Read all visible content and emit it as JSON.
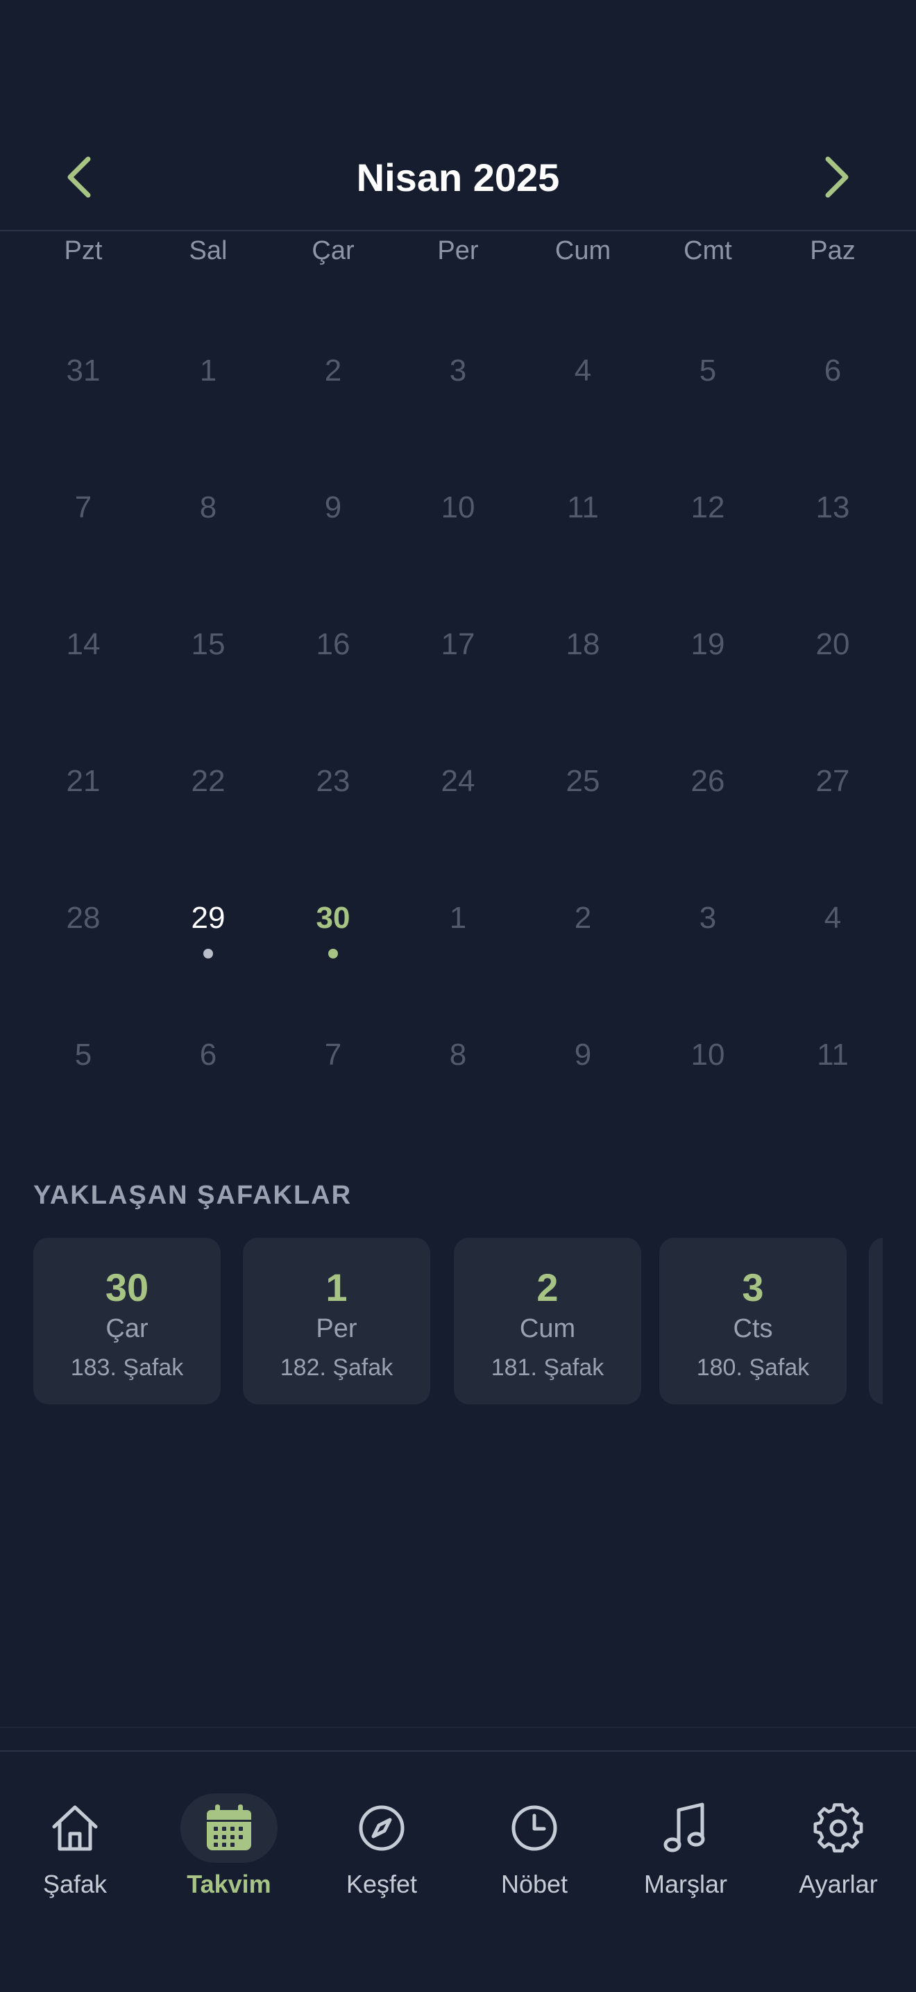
{
  "header": {
    "month_title": "Nisan 2025"
  },
  "weekdays": [
    "Pzt",
    "Sal",
    "Çar",
    "Per",
    "Cum",
    "Cmt",
    "Paz"
  ],
  "days": [
    {
      "label": "31"
    },
    {
      "label": "1"
    },
    {
      "label": "2"
    },
    {
      "label": "3"
    },
    {
      "label": "4"
    },
    {
      "label": "5"
    },
    {
      "label": "6"
    },
    {
      "label": "7"
    },
    {
      "label": "8"
    },
    {
      "label": "9"
    },
    {
      "label": "10"
    },
    {
      "label": "11"
    },
    {
      "label": "12"
    },
    {
      "label": "13"
    },
    {
      "label": "14"
    },
    {
      "label": "15"
    },
    {
      "label": "16"
    },
    {
      "label": "17"
    },
    {
      "label": "18"
    },
    {
      "label": "19"
    },
    {
      "label": "20"
    },
    {
      "label": "21"
    },
    {
      "label": "22"
    },
    {
      "label": "23"
    },
    {
      "label": "24"
    },
    {
      "label": "25"
    },
    {
      "label": "26"
    },
    {
      "label": "27"
    },
    {
      "label": "28"
    },
    {
      "label": "29",
      "state": "today",
      "dot": "#b9bec8"
    },
    {
      "label": "30",
      "state": "selected",
      "dot": "#a7c485"
    },
    {
      "label": "1"
    },
    {
      "label": "2"
    },
    {
      "label": "3"
    },
    {
      "label": "4"
    },
    {
      "label": "5"
    },
    {
      "label": "6"
    },
    {
      "label": "7"
    },
    {
      "label": "8"
    },
    {
      "label": "9"
    },
    {
      "label": "10"
    },
    {
      "label": "11"
    }
  ],
  "upcoming": {
    "title": "YAKLAŞAN ŞAFAKLAR",
    "cards": [
      {
        "day": "30",
        "weekday": "Çar",
        "safak": "183. Şafak"
      },
      {
        "day": "1",
        "weekday": "Per",
        "safak": "182. Şafak"
      },
      {
        "day": "2",
        "weekday": "Cum",
        "safak": "181. Şafak"
      },
      {
        "day": "3",
        "weekday": "Cts",
        "safak": "180. Şafak"
      }
    ]
  },
  "tabs": [
    {
      "label": "Şafak",
      "icon": "home-icon"
    },
    {
      "label": "Takvim",
      "icon": "calendar-icon",
      "active": true
    },
    {
      "label": "Keşfet",
      "icon": "compass-icon"
    },
    {
      "label": "Nöbet",
      "icon": "clock-icon"
    },
    {
      "label": "Marşlar",
      "icon": "music-note-icon"
    },
    {
      "label": "Ayarlar",
      "icon": "gear-icon"
    }
  ],
  "colors": {
    "background": "#161d2e",
    "accent": "#a7c485",
    "muted_day": "#525a6b",
    "card_bg": "#232b3b"
  }
}
